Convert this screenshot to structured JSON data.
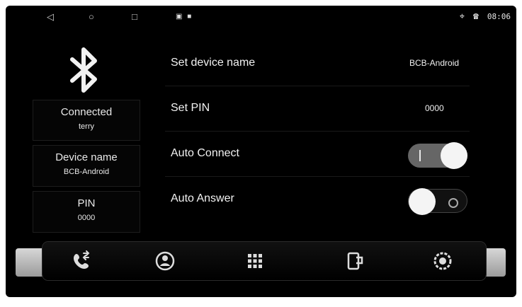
{
  "statusbar": {
    "time": "08:06",
    "icons": {
      "location": "location-pin-icon",
      "call": "phone-icon",
      "sys1": "image-icon",
      "sys2": "window-icon"
    },
    "nav": {
      "back": "◁",
      "home": "○",
      "recent": "□"
    }
  },
  "left_panel": {
    "connected": {
      "title": "Connected",
      "value": "terry"
    },
    "device_name": {
      "title": "Device name",
      "value": "BCB-Android"
    },
    "pin": {
      "title": "PIN",
      "value": "0000"
    }
  },
  "settings": {
    "device_name": {
      "label": "Set device name",
      "value": "BCB-Android"
    },
    "pin": {
      "label": "Set PIN",
      "value": "0000"
    },
    "auto_connect": {
      "label": "Auto Connect",
      "enabled": true
    },
    "auto_answer": {
      "label": "Auto Answer",
      "enabled": false
    }
  },
  "dock": {
    "items": [
      "phone-icon",
      "contacts-icon",
      "dialpad-icon",
      "transfer-icon",
      "settings-icon"
    ]
  }
}
